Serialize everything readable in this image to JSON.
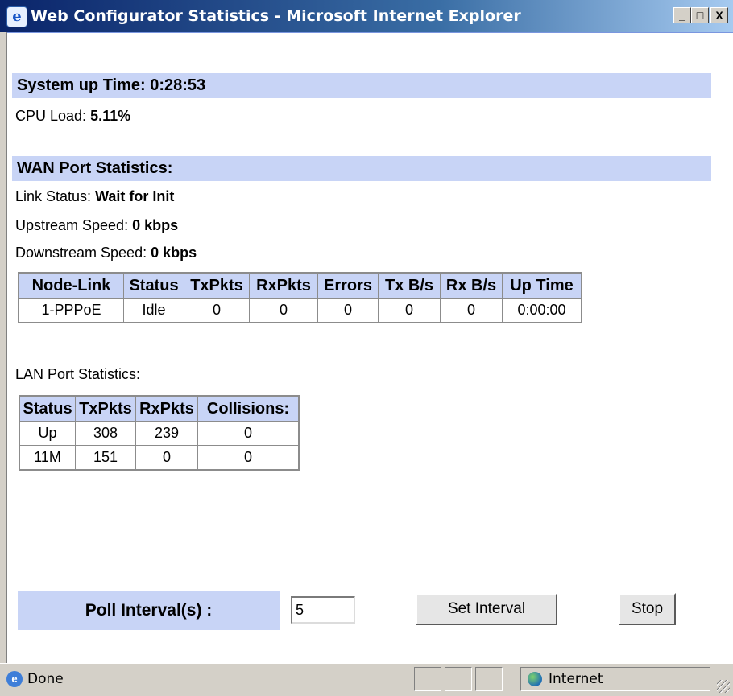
{
  "window": {
    "title": "Web Configurator Statistics - Microsoft Internet Explorer",
    "minimize": "_",
    "maximize": "□",
    "close": "X"
  },
  "system": {
    "uptime_label": "System up Time: 0:28:53",
    "cpu_label": "CPU Load:",
    "cpu_value": "5.11%"
  },
  "wan": {
    "heading": "WAN Port Statistics:",
    "link_status_label": "Link Status:",
    "link_status_value": "Wait for Init",
    "upstream_label": "Upstream Speed:",
    "upstream_value": "0 kbps",
    "downstream_label": "Downstream Speed:",
    "downstream_value": "0 kbps",
    "headers": [
      "Node-Link",
      "Status",
      "TxPkts",
      "RxPkts",
      "Errors",
      "Tx B/s",
      "Rx B/s",
      "Up Time"
    ],
    "rows": [
      [
        "1-PPPoE",
        "Idle",
        "0",
        "0",
        "0",
        "0",
        "0",
        "0:00:00"
      ]
    ]
  },
  "lan": {
    "heading": "LAN Port Statistics:",
    "headers": [
      "Status",
      "TxPkts",
      "RxPkts",
      "Collisions:"
    ],
    "rows": [
      [
        "Up",
        "308",
        "239",
        "0"
      ],
      [
        "11M",
        "151",
        "0",
        "0"
      ]
    ]
  },
  "poll": {
    "label": "Poll Interval(s) :",
    "value": "5",
    "set_button": "Set Interval",
    "stop_button": "Stop"
  },
  "statusbar": {
    "status_text": "Done",
    "zone_text": "Internet"
  }
}
